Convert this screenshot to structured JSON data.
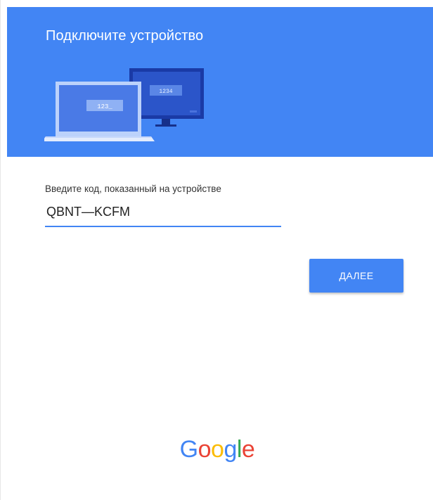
{
  "header": {
    "title": "Подключите устройство",
    "background_color": "#4285f4",
    "illustration": {
      "laptop_code": "123_",
      "monitor_code": "1234"
    }
  },
  "form": {
    "label": "Введите код, показанный на устройстве",
    "code_value": "QBNT—KCFM",
    "accent_color": "#4285f4"
  },
  "actions": {
    "next_label": "ДАЛЕЕ"
  },
  "footer": {
    "logo_text": "Google",
    "logo_letters": [
      {
        "char": "G",
        "color": "#4285f4"
      },
      {
        "char": "o",
        "color": "#ea4335"
      },
      {
        "char": "o",
        "color": "#fbbc05"
      },
      {
        "char": "g",
        "color": "#4285f4"
      },
      {
        "char": "l",
        "color": "#34a853"
      },
      {
        "char": "e",
        "color": "#ea4335"
      }
    ]
  }
}
